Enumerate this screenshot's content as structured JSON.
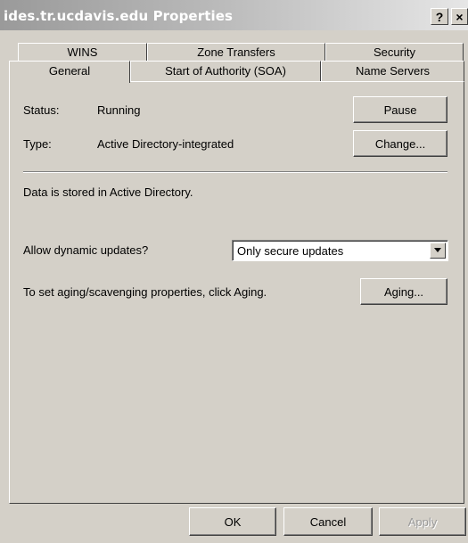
{
  "window": {
    "title": "ides.tr.ucdavis.edu Properties",
    "help_glyph": "?",
    "close_glyph": "×"
  },
  "tabs": {
    "row1": [
      "WINS",
      "Zone Transfers",
      "Security"
    ],
    "row2": [
      "General",
      "Start of Authority (SOA)",
      "Name Servers"
    ],
    "active": "General"
  },
  "general": {
    "status_label": "Status:",
    "status_value": "Running",
    "type_label": "Type:",
    "type_value": "Active Directory-integrated",
    "pause_button": "Pause",
    "change_button": "Change...",
    "storage_text": "Data is stored in Active Directory.",
    "dynamic_updates_label": "Allow dynamic updates?",
    "dynamic_updates_value": "Only secure updates",
    "aging_text": "To set aging/scavenging properties, click Aging.",
    "aging_button": "Aging..."
  },
  "footer": {
    "ok": "OK",
    "cancel": "Cancel",
    "apply": "Apply",
    "apply_enabled": false
  },
  "icons": {
    "dropdown": "chevron-down-icon",
    "help": "help-icon",
    "close": "close-icon"
  }
}
